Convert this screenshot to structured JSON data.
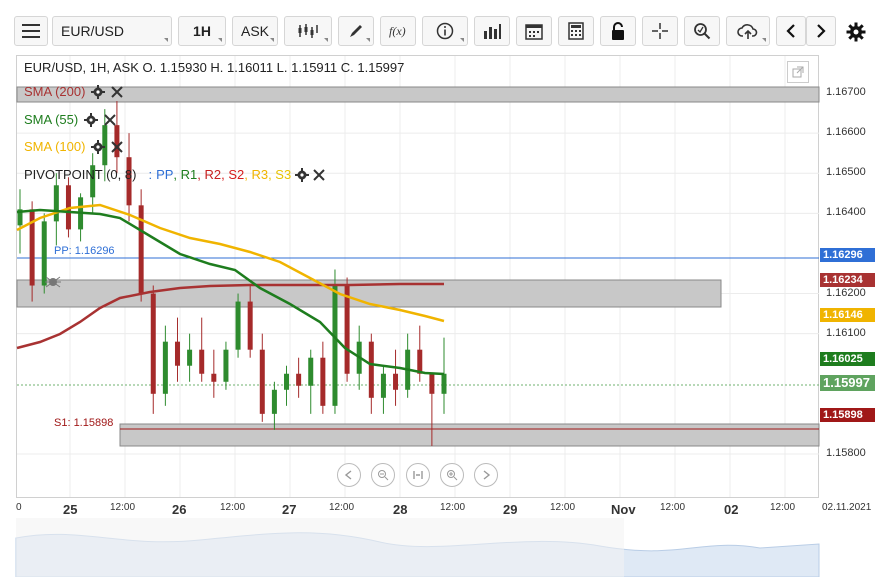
{
  "toolbar": {
    "symbol": "EUR/USD",
    "timeframe": "1H",
    "price_type": "ASK",
    "icons": [
      "menu-icon",
      "candles-icon",
      "pencil-icon",
      "function-icon",
      "info-icon",
      "bar-chart-icon",
      "calendar-icon",
      "calculator-icon",
      "lock-icon",
      "crosshair-icon",
      "zoom-icon",
      "cloud-upload-icon",
      "arrow-left-icon",
      "arrow-right-icon",
      "gear-icon"
    ]
  },
  "header": {
    "ohlc": "EUR/USD, 1H, ASK    O. 1.15930 H. 1.16011 L. 1.15911 C. 1.15997"
  },
  "indicators": {
    "sma200": {
      "label": "SMA (200)",
      "color": "#a83232"
    },
    "sma55": {
      "label": "SMA (55)",
      "color": "#1e7d1e"
    },
    "sma100": {
      "label": "SMA (100)",
      "color": "#f0b400"
    },
    "pivot": {
      "label": "PIVOTPOINT (0, 8)",
      "sep": ":",
      "parts": [
        {
          "text": "PP",
          "color": "#2f6fd6"
        },
        {
          "text": "R1",
          "color": "#1e7d1e"
        },
        {
          "text": "R2",
          "color": "#c62020"
        },
        {
          "text": "S2",
          "color": "#d61c1c"
        },
        {
          "text": "R3",
          "color": "#f0b400"
        },
        {
          "text": "S3",
          "color": "#e8c400"
        }
      ]
    }
  },
  "levels": {
    "pp_label": "PP: 1.16296",
    "s1_label": "S1: 1.15898"
  },
  "price_axis": {
    "ticks": [
      "1.16700",
      "1.16600",
      "1.16500",
      "1.16400",
      "1.16200",
      "1.16100",
      "1.15800"
    ],
    "tags": [
      {
        "value": "1.16296",
        "color": "#2f6fd6"
      },
      {
        "value": "1.16234",
        "color": "#a83232"
      },
      {
        "value": "1.16146",
        "color": "#f0b400"
      },
      {
        "value": "1.16025",
        "color": "#1e7d1e"
      },
      {
        "value": "1.15997",
        "color": "#5fa35f"
      },
      {
        "value": "1.15898",
        "color": "#a01818"
      }
    ]
  },
  "time_axis": {
    "labels": [
      {
        "text": "0",
        "bold": false
      },
      {
        "text": "25",
        "bold": true
      },
      {
        "text": "12:00",
        "bold": false
      },
      {
        "text": "26",
        "bold": true
      },
      {
        "text": "12:00",
        "bold": false
      },
      {
        "text": "27",
        "bold": true
      },
      {
        "text": "12:00",
        "bold": false
      },
      {
        "text": "28",
        "bold": true
      },
      {
        "text": "12:00",
        "bold": false
      },
      {
        "text": "29",
        "bold": true
      },
      {
        "text": "12:00",
        "bold": false
      },
      {
        "text": "Nov",
        "bold": true
      },
      {
        "text": "12:00",
        "bold": false
      },
      {
        "text": "02",
        "bold": true
      },
      {
        "text": "12:00",
        "bold": false
      },
      {
        "text": "02.11.2021",
        "bold": false
      }
    ]
  },
  "nav_controls": [
    "arrow-left-icon",
    "zoom-out-icon",
    "reset-icon",
    "zoom-in-icon",
    "arrow-right-icon"
  ],
  "chart_data": {
    "type": "candlestick",
    "title": "EUR/USD, 1H, ASK",
    "ylim": [
      1.1575,
      1.1675
    ],
    "candles_ohlc": [
      [
        1.1637,
        1.1646,
        1.163,
        1.1641
      ],
      [
        1.1641,
        1.1643,
        1.1618,
        1.1622
      ],
      [
        1.1622,
        1.164,
        1.162,
        1.1638
      ],
      [
        1.1638,
        1.165,
        1.1632,
        1.1647
      ],
      [
        1.1647,
        1.1649,
        1.1634,
        1.1636
      ],
      [
        1.1636,
        1.1645,
        1.1633,
        1.1644
      ],
      [
        1.1644,
        1.1655,
        1.164,
        1.1652
      ],
      [
        1.1652,
        1.1666,
        1.1648,
        1.1662
      ],
      [
        1.1662,
        1.1668,
        1.165,
        1.1654
      ],
      [
        1.1654,
        1.166,
        1.1638,
        1.1642
      ],
      [
        1.1642,
        1.1646,
        1.1618,
        1.162
      ],
      [
        1.162,
        1.1622,
        1.159,
        1.1595
      ],
      [
        1.1595,
        1.1612,
        1.1592,
        1.1608
      ],
      [
        1.1608,
        1.1614,
        1.1598,
        1.1602
      ],
      [
        1.1602,
        1.161,
        1.1598,
        1.1606
      ],
      [
        1.1606,
        1.1614,
        1.1598,
        1.16
      ],
      [
        1.16,
        1.1606,
        1.1594,
        1.1598
      ],
      [
        1.1598,
        1.1608,
        1.1596,
        1.1606
      ],
      [
        1.1606,
        1.162,
        1.1604,
        1.1618
      ],
      [
        1.1618,
        1.1622,
        1.1604,
        1.1606
      ],
      [
        1.1606,
        1.161,
        1.1588,
        1.159
      ],
      [
        1.159,
        1.1598,
        1.1586,
        1.1596
      ],
      [
        1.1596,
        1.1602,
        1.1592,
        1.16
      ],
      [
        1.16,
        1.1604,
        1.1594,
        1.1597
      ],
      [
        1.1597,
        1.1606,
        1.159,
        1.1604
      ],
      [
        1.1604,
        1.1608,
        1.159,
        1.1592
      ],
      [
        1.1592,
        1.1626,
        1.159,
        1.1622
      ],
      [
        1.1622,
        1.1624,
        1.1598,
        1.16
      ],
      [
        1.16,
        1.1612,
        1.1596,
        1.1608
      ],
      [
        1.1608,
        1.161,
        1.159,
        1.1594
      ],
      [
        1.1594,
        1.1602,
        1.159,
        1.16
      ],
      [
        1.16,
        1.1606,
        1.1592,
        1.1596
      ],
      [
        1.1596,
        1.161,
        1.1594,
        1.1606
      ],
      [
        1.1606,
        1.1612,
        1.1598,
        1.16
      ],
      [
        1.16,
        1.1598,
        1.1582,
        1.1595
      ],
      [
        1.1595,
        1.1609,
        1.159,
        1.16
      ]
    ],
    "levels": {
      "PP": 1.16296,
      "S1": 1.15898
    }
  }
}
